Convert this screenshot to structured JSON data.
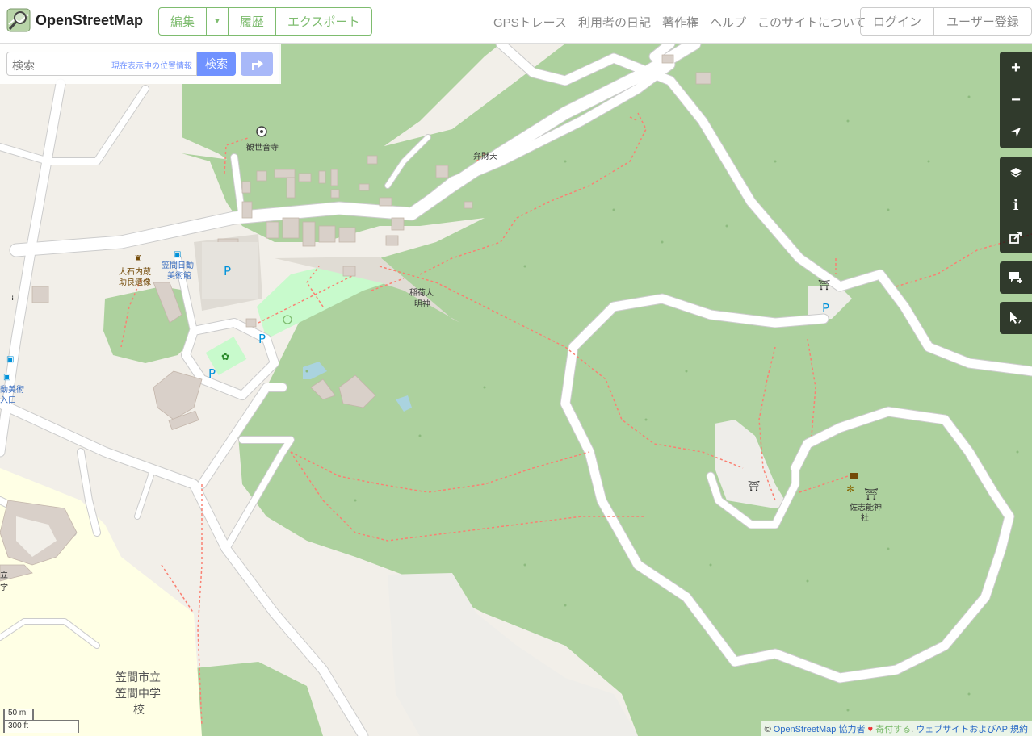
{
  "header": {
    "brand": "OpenStreetMap",
    "edit": "編集",
    "history": "履歴",
    "export": "エクスポート",
    "nav": [
      "GPSトレース",
      "利用者の日記",
      "著作権",
      "ヘルプ",
      "このサイトについて"
    ],
    "login": "ログイン",
    "signup": "ユーザー登録"
  },
  "search": {
    "placeholder": "検索",
    "where_am_i": "現在表示中の位置情報",
    "button": "検索"
  },
  "map_labels": {
    "kanzeonji": "観世音寺",
    "benzaiten": "弁財天",
    "oishi_1": "大石内蔵",
    "oishi_2": "助良遺像",
    "museum_1": "笠間日動",
    "museum_2": "美術館",
    "inari_1": "稲荷大",
    "inari_2": "明神",
    "sashino_1": "佐志能神",
    "sashino_2": "社",
    "edge_1": "動美術",
    "edge_2": "入口",
    "edge_3": "立",
    "edge_4": "学",
    "school_1": "笠間市立",
    "school_2": "笠間中学",
    "school_3": "校",
    "parking": "P"
  },
  "scale": {
    "metric": "50 m",
    "imperial": "300 ft"
  },
  "attribution": {
    "prefix": "©",
    "osm": "OpenStreetMap",
    "contributors": "協力者",
    "heart": "♥",
    "donate": "寄付する",
    "sep": ".",
    "terms": "ウェブサイトおよびAPI規約"
  },
  "colors": {
    "forest": "#add19e",
    "park": "#c8facc",
    "school": "#ffffe5",
    "road": "#ffffff",
    "building": "#d9d0c9",
    "path": "#fa8072",
    "accent": "#7ebc6f"
  }
}
